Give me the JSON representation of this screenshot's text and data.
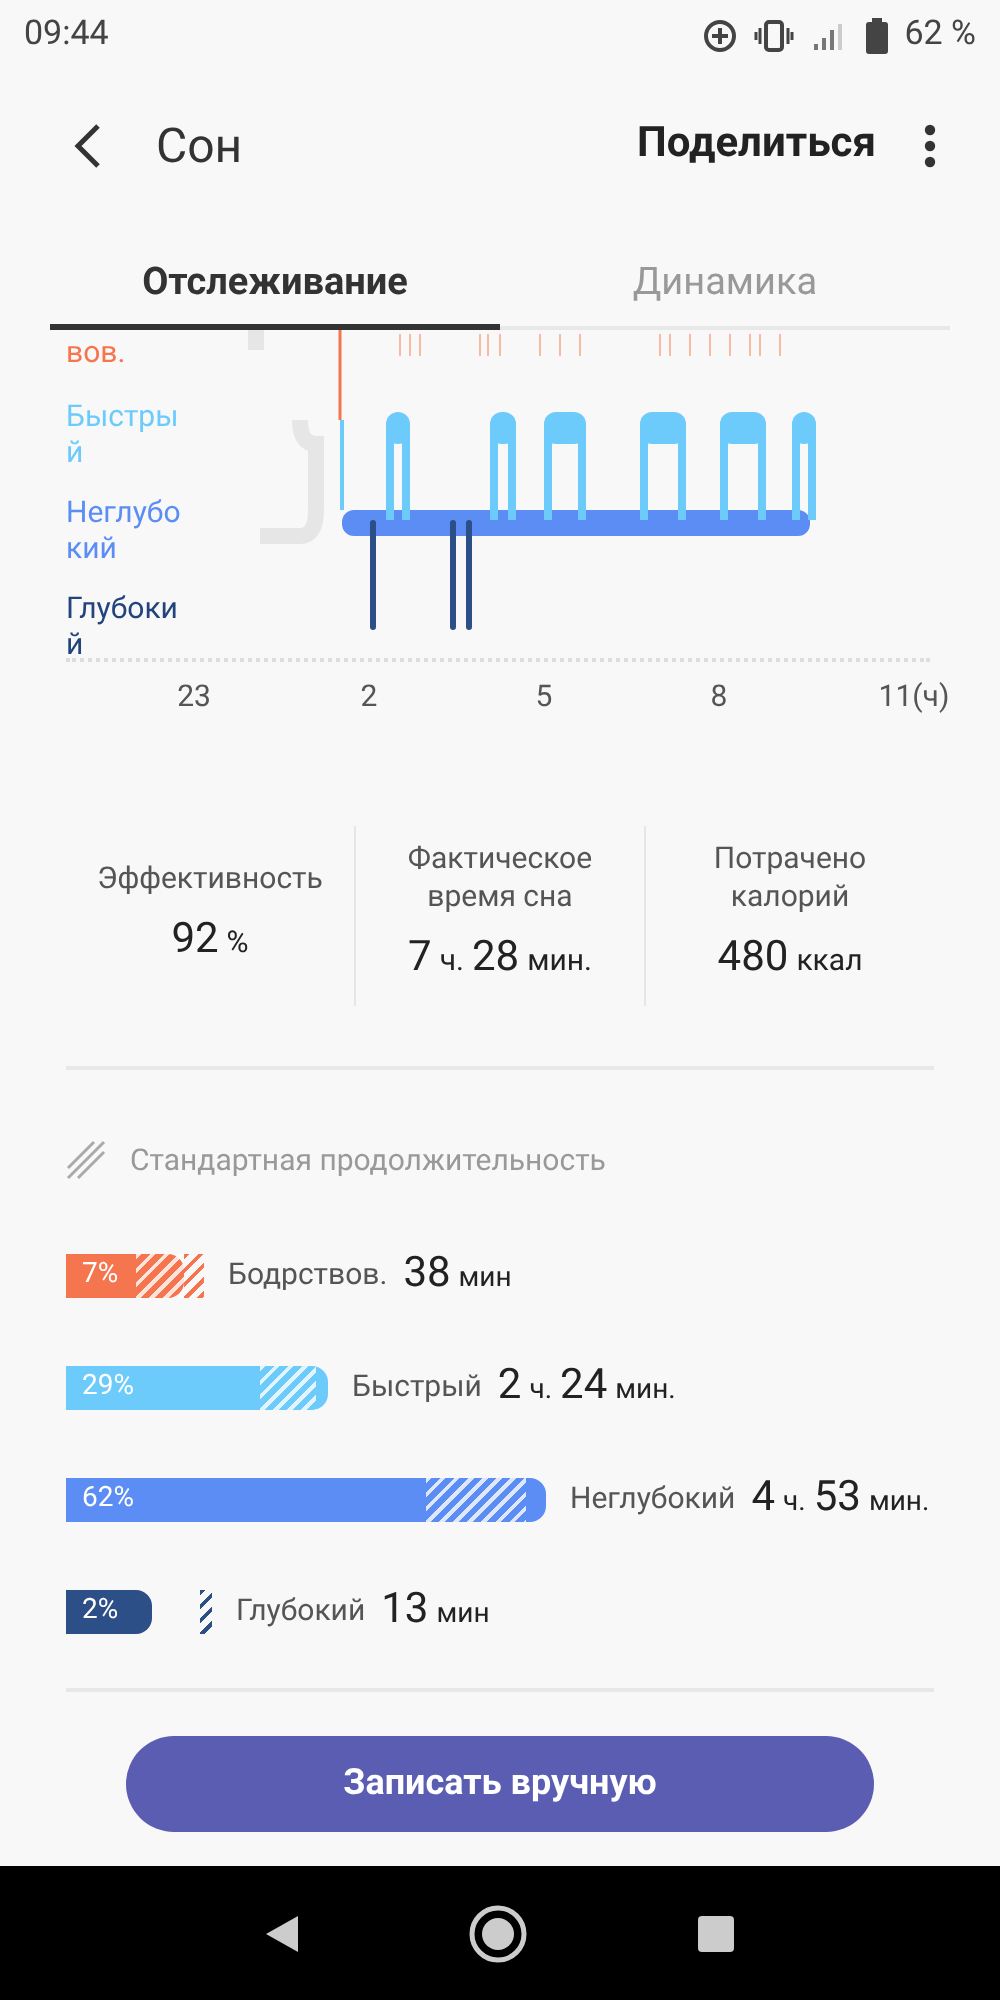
{
  "status_bar": {
    "time": "09:44",
    "battery": "62 %"
  },
  "header": {
    "title": "Сон",
    "share": "Поделиться"
  },
  "tabs": [
    {
      "label": "Отслеживание",
      "selected": true
    },
    {
      "label": "Динамика",
      "selected": false
    }
  ],
  "hypnogram": {
    "stage_labels": [
      {
        "text": "вов.",
        "color": "#f4754e"
      },
      {
        "text": "Быстры й",
        "color": "#6dcbfb"
      },
      {
        "text": "Неглубо кий",
        "color": "#5b8df5"
      },
      {
        "text": "Глубоки й",
        "color": "#23437c"
      }
    ],
    "x_labels": [
      "23",
      "2",
      "5",
      "8",
      "11(ч)"
    ]
  },
  "stats": [
    {
      "label": "Эффективность",
      "value": [
        {
          "text": "92",
          "kind": "number"
        },
        {
          "text": "%",
          "kind": "unit"
        }
      ]
    },
    {
      "label": "Фактическое время сна",
      "value": [
        {
          "text": "7",
          "kind": "number"
        },
        {
          "text": "ч.",
          "kind": "unit"
        },
        {
          "text": "28",
          "kind": "number"
        },
        {
          "text": "мин.",
          "kind": "unit"
        }
      ]
    },
    {
      "label": "Потрачено калорий",
      "value": [
        {
          "text": "480",
          "kind": "number"
        },
        {
          "text": "ккал",
          "kind": "unit"
        }
      ]
    }
  ],
  "legend": "Стандартная продолжительность",
  "stages": [
    {
      "percent": "7%",
      "name": "Бодрствов.",
      "color": "#f4754e",
      "value": [
        {
          "text": "38",
          "kind": "number"
        },
        {
          "text": "мин",
          "kind": "unit"
        }
      ]
    },
    {
      "percent": "29%",
      "name": "Быстрый",
      "color": "#6dcbfb",
      "value": [
        {
          "text": "2",
          "kind": "number"
        },
        {
          "text": "ч.",
          "kind": "unit"
        },
        {
          "text": "24",
          "kind": "number"
        },
        {
          "text": "мин.",
          "kind": "unit"
        }
      ]
    },
    {
      "percent": "62%",
      "name": "Неглубокий",
      "color": "#5b8df5",
      "value": [
        {
          "text": "4",
          "kind": "number"
        },
        {
          "text": "ч.",
          "kind": "unit"
        },
        {
          "text": "53",
          "kind": "number"
        },
        {
          "text": "мин.",
          "kind": "unit"
        }
      ]
    },
    {
      "percent": "2%",
      "name": "Глубокий",
      "color": "#2b4f86",
      "value": [
        {
          "text": "13",
          "kind": "number"
        },
        {
          "text": "мин",
          "kind": "unit"
        }
      ]
    }
  ],
  "button": "Записать вручную"
}
